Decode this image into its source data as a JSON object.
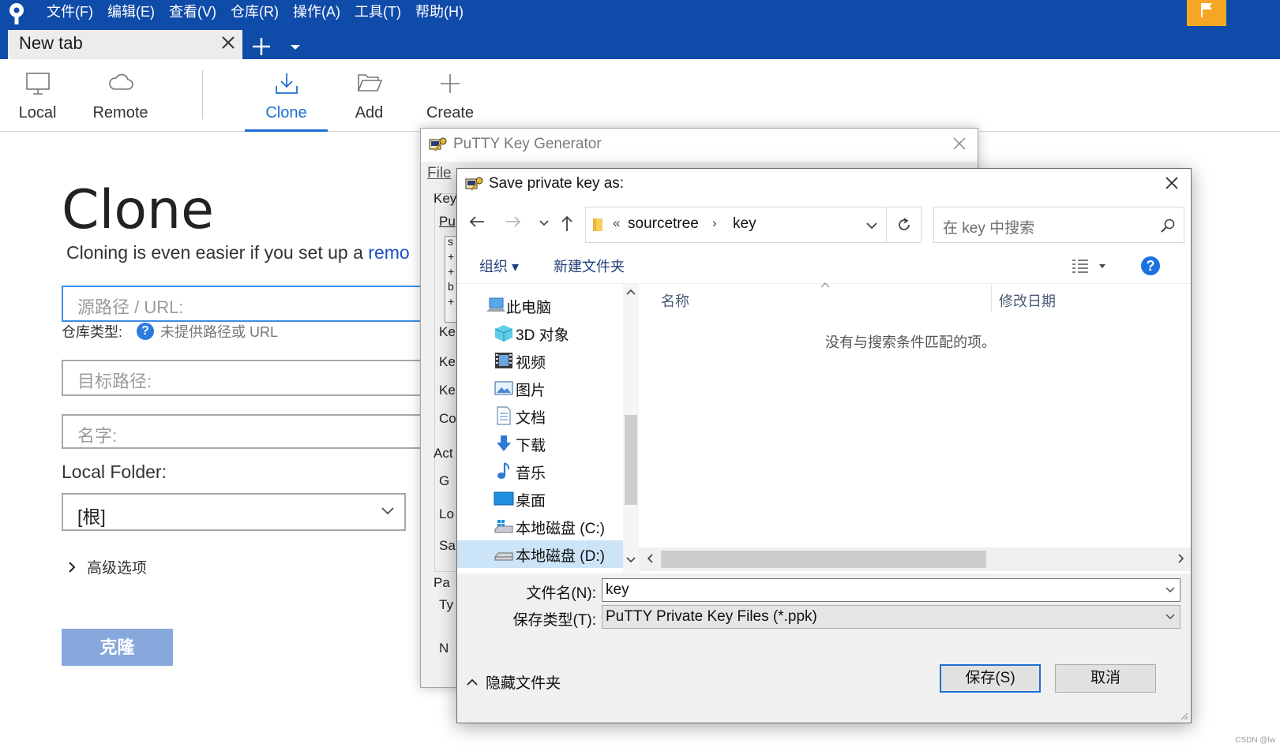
{
  "menu": [
    "文件(F)",
    "编辑(E)",
    "查看(V)",
    "仓库(R)",
    "操作(A)",
    "工具(T)",
    "帮助(H)"
  ],
  "tab": {
    "label": "New tab"
  },
  "toolbar": {
    "local": "Local",
    "remote": "Remote",
    "clone": "Clone",
    "add": "Add",
    "create": "Create"
  },
  "clone_page": {
    "title": "Clone",
    "subtitle": "Cloning is even easier if you set up a ",
    "subtitle_link": "remo",
    "source_placeholder": "源路径 / URL:",
    "repo_type_label": "仓库类型:",
    "repo_type_value": "未提供路径或 URL",
    "dest_placeholder": "目标路径:",
    "name_placeholder": "名字:",
    "local_folder_label": "Local Folder:",
    "local_folder_value": "[根]",
    "advanced_options": "高级选项",
    "clone_button": "克隆"
  },
  "putty": {
    "title": "PuTTY Key Generator",
    "menu_file": "File",
    "fragments": {
      "key": "Key",
      "pu": "Pu",
      "ke1": "Ke",
      "ke2": "Ke",
      "ke3": "Ke",
      "co": "Co",
      "act": "Act",
      "g": "G",
      "lo": "Lo",
      "sa": "Sa",
      "par": "Pa",
      "ty": "Ty",
      "nu": "N",
      "s": "s",
      "plus1": "+",
      "plus2": "+",
      "b": "b",
      "plus3": "+"
    }
  },
  "save_dialog": {
    "title": "Save private key as:",
    "breadcrumb": [
      "sourcetree",
      "key"
    ],
    "breadcrumb_prefix": "«",
    "search_placeholder": "在 key 中搜索",
    "organize": "组织 ▾",
    "new_folder": "新建文件夹",
    "help": "?",
    "tree": [
      "此电脑",
      "3D 对象",
      "视频",
      "图片",
      "文档",
      "下载",
      "音乐",
      "桌面",
      "本地磁盘 (C:)",
      "本地磁盘 (D:)"
    ],
    "columns": {
      "name": "名称",
      "date": "修改日期"
    },
    "empty_message": "没有与搜索条件匹配的项。",
    "filename_label": "文件名(N):",
    "filename_value": "key",
    "filetype_label": "保存类型(T):",
    "filetype_value": "PuTTY Private Key Files (*.ppk)",
    "hide_folders": "隐藏文件夹",
    "save_button": "保存(S)",
    "cancel_button": "取消"
  },
  "watermark": "CSDN @lw",
  "colors": {
    "titlebar": "#0f4ba8",
    "accent": "#1d6fd6",
    "flag": "#f5a623",
    "clone_button": "#86a8dc"
  }
}
